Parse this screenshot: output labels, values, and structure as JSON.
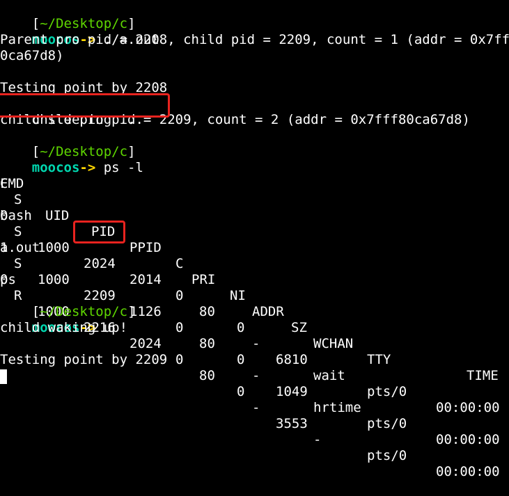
{
  "prompt": {
    "open_bracket": "[",
    "path": "~/Desktop/c",
    "close_bracket": "]",
    "host": "moocos",
    "arrow": "->"
  },
  "commands": {
    "run": " ./a.out",
    "ps": " ps -l"
  },
  "output": {
    "parent_line1": "Parent pro pid = 2208, child pid = 2209, count = 1 (addr = 0x7fff8",
    "parent_line2": "0ca67d8)",
    "testing_2208": "Testing point by 2208",
    "child_pid_part": "child pro pid = 2209,",
    "child_count_part": " count = 2 (addr = 0x7fff80ca67d8)",
    "child_sleeping": "child sleeping ...",
    "child_waking": "child waking up!",
    "testing_2209": "Testing point by 2209"
  },
  "ps_table": {
    "headers": {
      "f": "F",
      "s": "S",
      "uid": "UID",
      "pid": "PID",
      "ppid": "PPID",
      "c": "C",
      "pri": "PRI",
      "ni": "NI",
      "addr": "ADDR",
      "sz": "SZ",
      "wchan": "WCHAN",
      "tty": "TTY",
      "time": "TIME",
      "cmd": "CMD"
    },
    "rows": [
      {
        "f": "0",
        "s": "S",
        "uid": "1000",
        "pid": "2024",
        "ppid": "2014",
        "c": "0",
        "pri": "80",
        "ni": "0",
        "addr": "-",
        "sz": "6810",
        "wchan": "wait",
        "tty": "pts/0",
        "time": "00:00:00",
        "cmd": "bash"
      },
      {
        "f": "1",
        "s": "S",
        "uid": "1000",
        "pid": "2209",
        "ppid": "1126",
        "c": "0",
        "pri": "80",
        "ni": "0",
        "addr": "-",
        "sz": "1049",
        "wchan": "hrtime",
        "tty": "pts/0",
        "time": "00:00:00",
        "cmd": "a.out"
      },
      {
        "f": "0",
        "s": "R",
        "uid": "1000",
        "pid": "2216",
        "ppid": "2024",
        "c": "0",
        "pri": "80",
        "ni": "0",
        "addr": "-",
        "sz": "3553",
        "wchan": "-",
        "tty": "pts/0",
        "time": "00:00:00",
        "cmd": "ps"
      }
    ]
  },
  "colors": {
    "background": "#000000",
    "text": "#ffffff",
    "path": "#5fd700",
    "host": "#00d7af",
    "arrow": "#ffd700",
    "highlight": "#e8231f"
  }
}
